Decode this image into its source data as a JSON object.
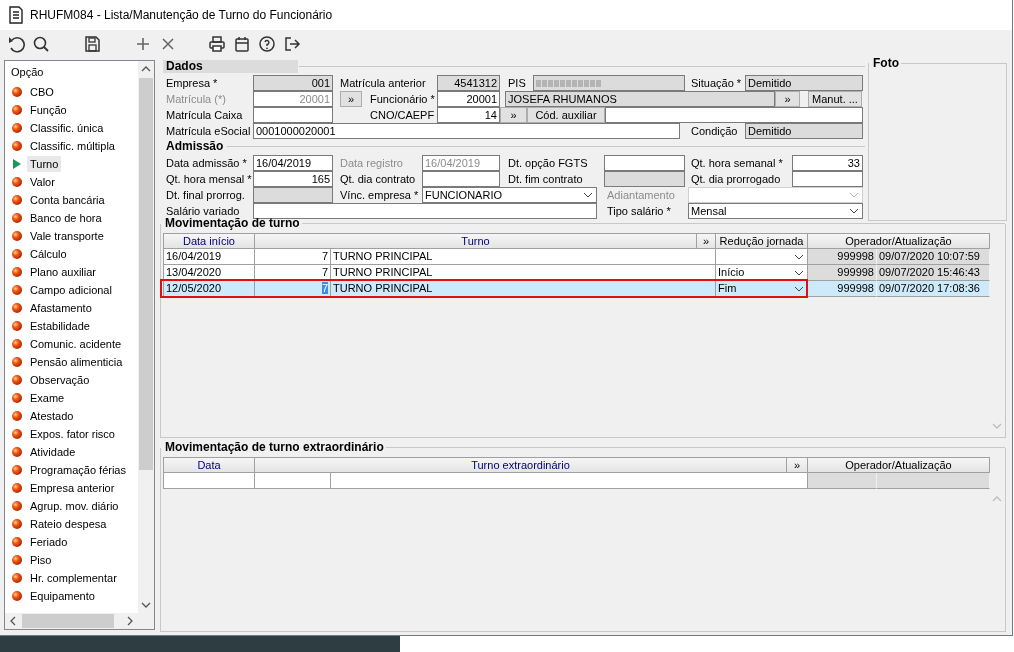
{
  "window": {
    "title": "RHUFM084 - Lista/Manutenção de Turno do Funcionário"
  },
  "toolbar": {
    "buttons": [
      {
        "kind": "undo"
      },
      {
        "kind": "search"
      },
      {
        "kind": "save"
      },
      {
        "kind": "add"
      },
      {
        "kind": "delete"
      },
      {
        "kind": "print"
      },
      {
        "kind": "calendar"
      },
      {
        "kind": "help"
      },
      {
        "kind": "exit"
      }
    ]
  },
  "sidebar": {
    "header": "Opção",
    "items": [
      {
        "label": "CBO",
        "selected": false
      },
      {
        "label": "Função",
        "selected": false
      },
      {
        "label": "Classific. única",
        "selected": false
      },
      {
        "label": "Classific. múltipla",
        "selected": false
      },
      {
        "label": "Turno",
        "selected": true
      },
      {
        "label": "Valor",
        "selected": false
      },
      {
        "label": "Conta bancária",
        "selected": false
      },
      {
        "label": "Banco de hora",
        "selected": false
      },
      {
        "label": "Vale transporte",
        "selected": false
      },
      {
        "label": "Cálculo",
        "selected": false
      },
      {
        "label": "Plano auxiliar",
        "selected": false
      },
      {
        "label": "Campo adicional",
        "selected": false
      },
      {
        "label": "Afastamento",
        "selected": false
      },
      {
        "label": "Estabilidade",
        "selected": false
      },
      {
        "label": "Comunic. acidente",
        "selected": false
      },
      {
        "label": "Pensão alimenticia",
        "selected": false
      },
      {
        "label": "Observação",
        "selected": false
      },
      {
        "label": "Exame",
        "selected": false
      },
      {
        "label": "Atestado",
        "selected": false
      },
      {
        "label": "Expos. fator risco",
        "selected": false
      },
      {
        "label": "Atividade",
        "selected": false
      },
      {
        "label": "Programação férias",
        "selected": false
      },
      {
        "label": "Empresa anterior",
        "selected": false
      },
      {
        "label": "Agrup. mov. diário",
        "selected": false
      },
      {
        "label": "Rateio despesa",
        "selected": false
      },
      {
        "label": "Feriado",
        "selected": false
      },
      {
        "label": "Piso",
        "selected": false
      },
      {
        "label": "Hr. complementar",
        "selected": false
      },
      {
        "label": "Equipamento",
        "selected": false
      }
    ]
  },
  "dados": {
    "title": "Dados",
    "rows": [
      {
        "items": [
          {
            "kind": "label",
            "text": "Empresa *"
          },
          {
            "kind": "field",
            "value": "001",
            "readonly": true
          },
          {
            "kind": "label",
            "text": "Matrícula anterior"
          },
          {
            "kind": "field",
            "value": "4541312",
            "readonly": true
          },
          {
            "kind": "label",
            "text": "PIS"
          },
          {
            "kind": "field",
            "masked": true,
            "readonly": true
          },
          {
            "kind": "label",
            "text": "Situação *"
          },
          {
            "kind": "field",
            "value": "Demitido",
            "readonly": true
          }
        ]
      },
      {
        "items": [
          {
            "kind": "label",
            "text": "Matrícula (*)",
            "disabled": true
          },
          {
            "kind": "field",
            "value": "20001",
            "disabled": true
          },
          {
            "kind": "button",
            "label": "»"
          },
          {
            "kind": "label",
            "text": "Funcionário *"
          },
          {
            "kind": "field",
            "value": "20001"
          },
          {
            "kind": "field",
            "value": "JOSEFA RHUMANOS",
            "readonly": true
          },
          {
            "kind": "button",
            "label": "»"
          },
          {
            "kind": "button",
            "label": "Manut. ..."
          }
        ]
      },
      {
        "items": [
          {
            "kind": "label",
            "text": "Matrícula Caixa"
          },
          {
            "kind": "field"
          },
          {
            "kind": "label",
            "text": "CNO/CAEPF"
          },
          {
            "kind": "field",
            "value": "14"
          },
          {
            "kind": "button",
            "label": "»"
          },
          {
            "kind": "button",
            "label": "Cód. auxiliar"
          },
          {
            "kind": "field"
          }
        ]
      },
      {
        "items": [
          {
            "kind": "label",
            "text": "Matrícula eSocial"
          },
          {
            "kind": "field",
            "value": "0001000020001"
          },
          {
            "kind": "label",
            "text": "Condição"
          },
          {
            "kind": "field",
            "value": "Demitido",
            "readonly": true
          }
        ]
      }
    ]
  },
  "admissao": {
    "title": "Admissão",
    "rows": [
      {
        "items": [
          {
            "kind": "label",
            "text": "Data admissão *"
          },
          {
            "kind": "field",
            "value": "16/04/2019"
          },
          {
            "kind": "label",
            "text": "Data registro",
            "disabled": true
          },
          {
            "kind": "field",
            "value": "16/04/2019",
            "disabled": true
          },
          {
            "kind": "label",
            "text": "Dt. opção FGTS"
          },
          {
            "kind": "field"
          },
          {
            "kind": "label",
            "text": "Qt. hora semanal *"
          },
          {
            "kind": "field",
            "value": "33"
          }
        ]
      },
      {
        "items": [
          {
            "kind": "label",
            "text": "Qt. hora mensal *"
          },
          {
            "kind": "field",
            "value": "165"
          },
          {
            "kind": "label",
            "text": "Qt. dia contrato"
          },
          {
            "kind": "field"
          },
          {
            "kind": "label",
            "text": "Dt. fim contrato"
          },
          {
            "kind": "field",
            "readonly": true
          },
          {
            "kind": "label",
            "text": "Qt. dia prorrogado"
          },
          {
            "kind": "field"
          }
        ]
      },
      {
        "items": [
          {
            "kind": "label",
            "text": "Dt. final prorrog."
          },
          {
            "kind": "field",
            "readonly": true
          },
          {
            "kind": "label",
            "text": "Vínc. empresa *"
          },
          {
            "kind": "select",
            "value": "FUNCIONARIO"
          },
          {
            "kind": "label",
            "text": "Adiantamento",
            "disabled": true
          },
          {
            "kind": "select",
            "disabled": true
          }
        ]
      },
      {
        "items": [
          {
            "kind": "label",
            "text": "Salário variado"
          },
          {
            "kind": "field"
          },
          {
            "kind": "label",
            "text": "Tipo salário *"
          },
          {
            "kind": "select",
            "value": "Mensal"
          }
        ]
      }
    ]
  },
  "foto": {
    "title": "Foto"
  },
  "turno_grid": {
    "title": "Movimentação de turno",
    "columns": [
      {
        "label": "Data início"
      },
      {
        "label": "Turno"
      },
      {
        "label": "»"
      },
      {
        "label": "Redução jornada"
      },
      {
        "label": "Operador/Atualização"
      }
    ],
    "rows": [
      {
        "data_inicio": "16/04/2019",
        "codigo": "7",
        "turno": "TURNO PRINCIPAL",
        "operador": "999998",
        "atualizacao": "09/07/2020 10:07:59",
        "selected": false
      },
      {
        "data_inicio": "13/04/2020",
        "codigo": "7",
        "turno": "TURNO PRINCIPAL",
        "reducao": "Início",
        "operador": "999998",
        "atualizacao": "09/07/2020 15:46:43",
        "selected": false
      },
      {
        "data_inicio": "12/05/2020",
        "codigo": "7",
        "turno": "TURNO PRINCIPAL",
        "reducao": "Fim",
        "operador": "999998",
        "atualizacao": "09/07/2020 17:08:36",
        "selected": true
      }
    ]
  },
  "extra_grid": {
    "title": "Movimentação de turno extraordinário",
    "columns": [
      {
        "label": "Data"
      },
      {
        "label": "Turno extraordinário"
      },
      {
        "label": "»"
      },
      {
        "label": "Operador/Atualização"
      }
    ],
    "rows": [
      {}
    ]
  }
}
